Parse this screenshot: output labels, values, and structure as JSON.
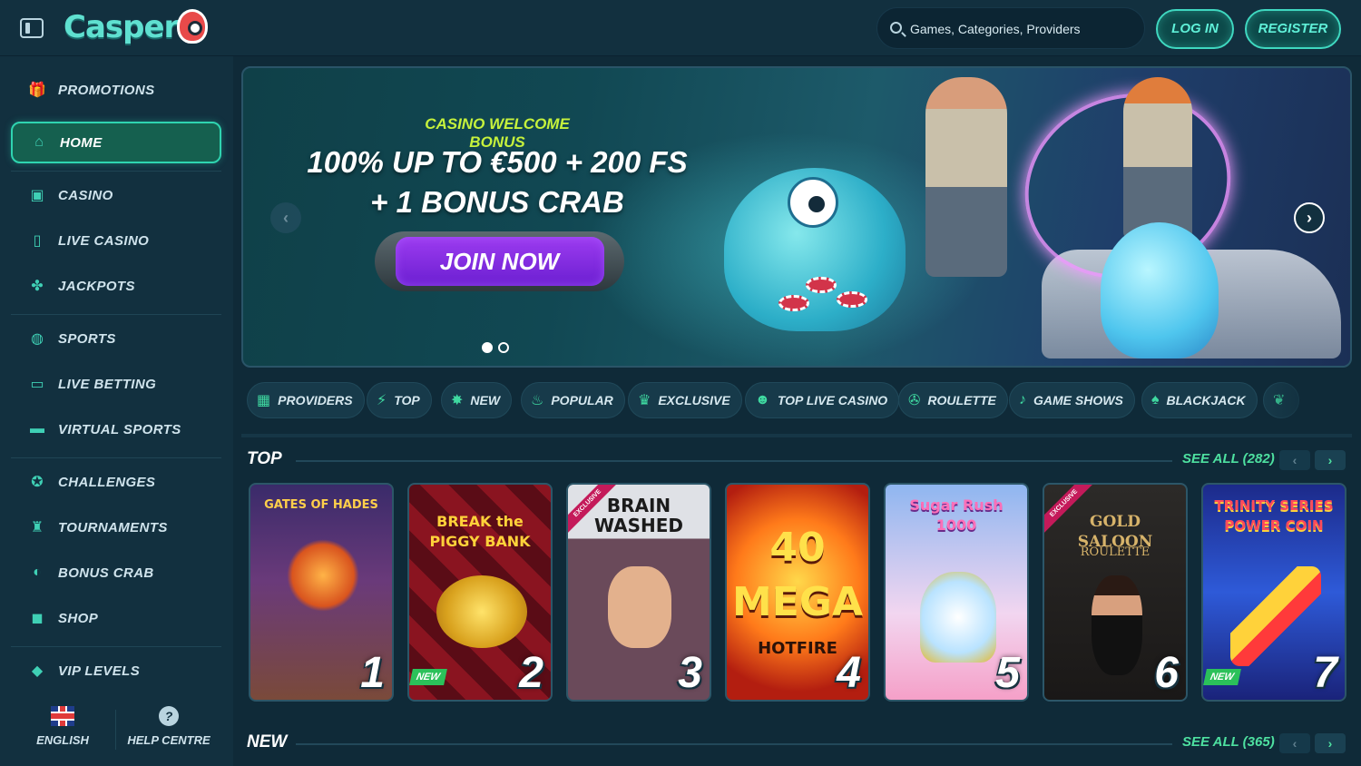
{
  "header": {
    "logo": "Casper",
    "search_placeholder": "Games, Categories, Providers",
    "login_label": "LOG IN",
    "register_label": "REGISTER"
  },
  "sidebar": {
    "items": [
      {
        "label": "PROMOTIONS",
        "icon": "gift-icon"
      },
      {
        "label": "HOME",
        "icon": "home-icon",
        "active": true
      },
      {
        "label": "CASINO",
        "icon": "slot-machine-icon"
      },
      {
        "label": "LIVE CASINO",
        "icon": "phone-card-icon"
      },
      {
        "label": "JACKPOTS",
        "icon": "clover-icon"
      },
      {
        "label": "SPORTS",
        "icon": "ball-icon"
      },
      {
        "label": "LIVE BETTING",
        "icon": "live-tv-icon"
      },
      {
        "label": "VIRTUAL SPORTS",
        "icon": "monitor-icon"
      },
      {
        "label": "CHALLENGES",
        "icon": "medal-icon"
      },
      {
        "label": "TOURNAMENTS",
        "icon": "trophy-icon"
      },
      {
        "label": "BONUS CRAB",
        "icon": "crab-icon"
      },
      {
        "label": "SHOP",
        "icon": "shopping-bag-icon"
      },
      {
        "label": "VIP LEVELS",
        "icon": "diamond-icon"
      }
    ],
    "footer": {
      "language_label": "ENGLISH",
      "help_label": "HELP CENTRE",
      "help_glyph": "?"
    }
  },
  "banner": {
    "subtitle": "CASINO WELCOME BONUS",
    "title_line1": "100% UP TO €500 + 200 FS",
    "title_line2": "+ 1 BONUS CRAB",
    "cta_label": "JOIN NOW",
    "slides_total": 2,
    "slide_active": 1
  },
  "categories": [
    {
      "label": "PROVIDERS",
      "icon": "grid-icon"
    },
    {
      "label": "TOP",
      "icon": "lightning-icon"
    },
    {
      "label": "NEW",
      "icon": "badge-icon"
    },
    {
      "label": "POPULAR",
      "icon": "flame-icon"
    },
    {
      "label": "EXCLUSIVE",
      "icon": "crown-icon"
    },
    {
      "label": "TOP LIVE CASINO",
      "icon": "dealer-icon"
    },
    {
      "label": "ROULETTE",
      "icon": "roulette-icon"
    },
    {
      "label": "GAME SHOWS",
      "icon": "microphone-icon"
    },
    {
      "label": "BLACKJACK",
      "icon": "cards-icon"
    }
  ],
  "sections": {
    "top": {
      "title": "TOP",
      "see_all": "SEE ALL (282)"
    },
    "new": {
      "title": "NEW",
      "see_all": "SEE ALL (365)"
    }
  },
  "games": [
    {
      "title": "GATES OF HADES",
      "rank": "1"
    },
    {
      "title": "BREAK the PIGGY BANK",
      "rank": "2",
      "new": "NEW"
    },
    {
      "title": "BRAIN WASHED",
      "rank": "3",
      "exclusive": "EXCLUSIVE"
    },
    {
      "title": "40 MEGA",
      "subtitle": "HOTFIRE",
      "rank": "4"
    },
    {
      "title": "Sugar Rush 1000",
      "rank": "5"
    },
    {
      "title": "GOLD SALOON",
      "subtitle": "ROULETTE",
      "rank": "6",
      "exclusive": "EXCLUSIVE"
    },
    {
      "title": "TRINITY SERIES POWER COIN",
      "rank": "7",
      "new": "NEW"
    }
  ],
  "colors": {
    "accent": "#3fd8c0",
    "promo_green": "#c6f23c",
    "cta_purple": "#7a28dd",
    "see_all": "#4ee0a0"
  }
}
